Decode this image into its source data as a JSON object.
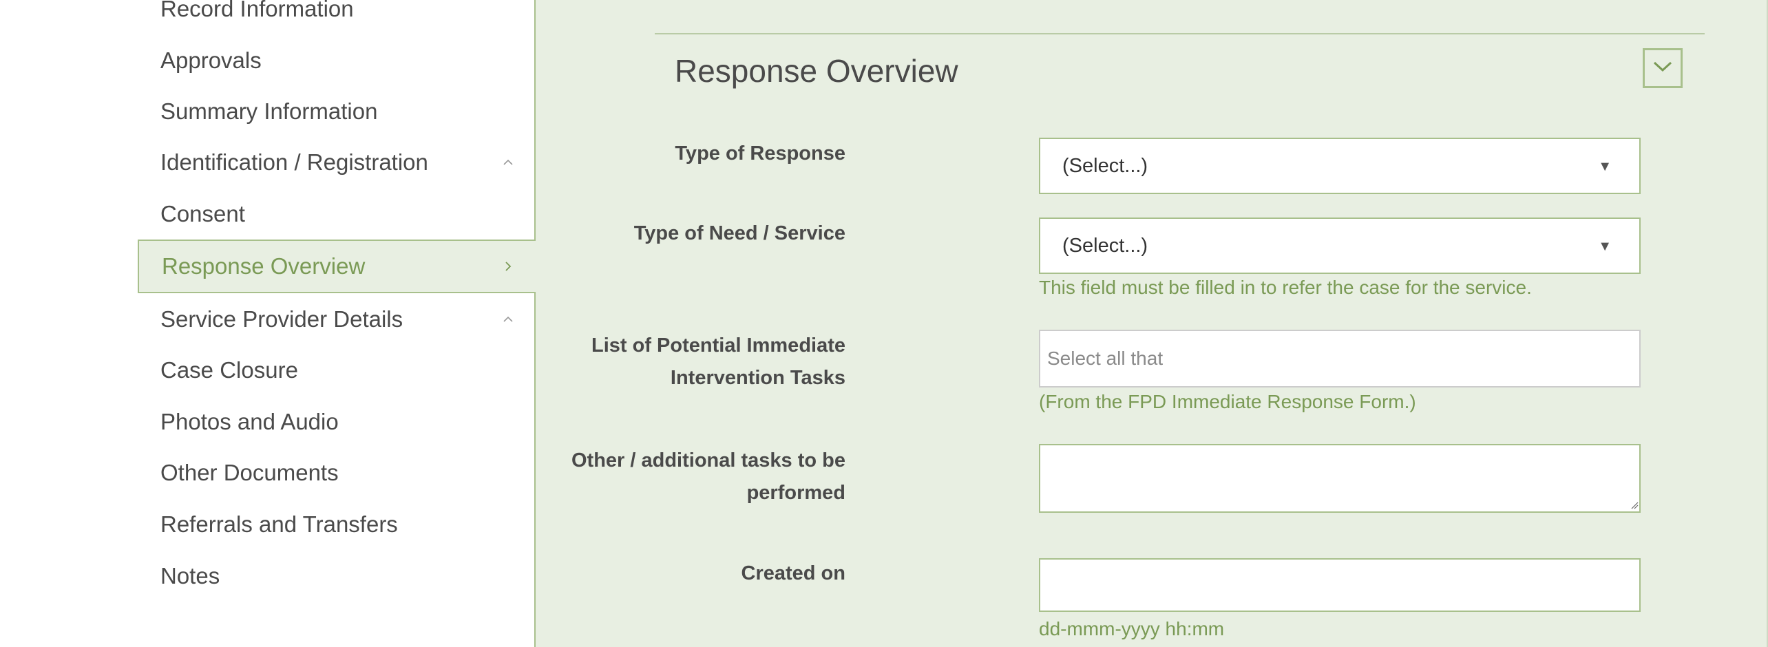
{
  "sidebar": {
    "items": [
      {
        "label": "Record Information"
      },
      {
        "label": "Approvals"
      },
      {
        "label": "Summary Information"
      },
      {
        "label": "Identification / Registration"
      },
      {
        "label": "Consent"
      },
      {
        "label": "Response Overview"
      },
      {
        "label": "Service Provider Details"
      },
      {
        "label": "Case Closure"
      },
      {
        "label": "Photos and Audio"
      },
      {
        "label": "Other Documents"
      },
      {
        "label": "Referrals and Transfers"
      },
      {
        "label": "Notes"
      }
    ]
  },
  "section": {
    "title": "Response Overview"
  },
  "fields": {
    "type_of_response": {
      "label": "Type of Response",
      "value": "(Select...)"
    },
    "type_of_need": {
      "label": "Type of Need / Service",
      "value": "(Select...)",
      "help": "This field must be filled in to refer the case for the service."
    },
    "intervention_tasks": {
      "label_line1": "List of Potential Immediate",
      "label_line2": "Intervention Tasks",
      "placeholder": "Select all that",
      "help": "(From the FPD Immediate Response Form.)"
    },
    "other_tasks": {
      "label_line1": "Other / additional tasks to be",
      "label_line2": "performed",
      "value": ""
    },
    "created_on": {
      "label": "Created on",
      "value": "",
      "help": "dd-mmm-yyyy hh:mm"
    }
  },
  "colors": {
    "accent": "#7a9a55",
    "border": "#a8c08c",
    "panel_bg": "#e8efe2"
  }
}
